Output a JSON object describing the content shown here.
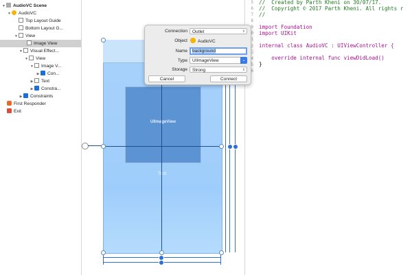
{
  "outline": {
    "items": [
      {
        "label": "AudioVC Scene",
        "bold": true
      },
      {
        "label": "AudioVC"
      },
      {
        "label": "Top Layout Guide"
      },
      {
        "label": "Bottom Layout G..."
      },
      {
        "label": "View"
      },
      {
        "label": "Image View",
        "selected": true
      },
      {
        "label": "Visual Effect..."
      },
      {
        "label": "View"
      },
      {
        "label": "Image V..."
      },
      {
        "label": "Con..."
      },
      {
        "label": "Text"
      },
      {
        "label": "Constra..."
      },
      {
        "label": "Constraints"
      },
      {
        "label": "First Responder"
      },
      {
        "label": "Exit"
      }
    ]
  },
  "canvas": {
    "image_view_label": "UIImageView",
    "text_label": "Text"
  },
  "popover": {
    "connection_label": "Connection",
    "connection_value": "Outlet",
    "object_label": "Object",
    "object_value": "AudioVC",
    "name_label": "Name",
    "name_value": "background",
    "type_label": "Type",
    "type_value": "UIImageView",
    "storage_label": "Storage",
    "storage_value": "Strong",
    "cancel": "Cancel",
    "connect": "Connect"
  },
  "editor": {
    "lines": [
      {
        "num": "5",
        "text": "//  Created by Parth Kheni on 30/07/17.",
        "style": "cm"
      },
      {
        "num": "6",
        "text": "//  Copyright © 2017 Parth Kheni. All rights r",
        "style": "cm"
      },
      {
        "num": "7",
        "text": "//",
        "style": "cm"
      },
      {
        "num": "8",
        "text": "",
        "style": ""
      },
      {
        "num": "9",
        "text": "import Foundation",
        "style": "imp"
      },
      {
        "num": "10",
        "text": "import UIKit",
        "style": "imp"
      },
      {
        "num": "11",
        "text": "",
        "style": ""
      },
      {
        "num": "12",
        "text": "internal class AudioVC : UIViewController {",
        "style": "cls"
      },
      {
        "num": "13",
        "text": "",
        "style": ""
      },
      {
        "num": "14",
        "text": "    override internal func viewDidLoad()",
        "style": "fn"
      },
      {
        "num": "15",
        "text": "",
        "style": ""
      },
      {
        "num": "16",
        "text": "}",
        "style": ""
      }
    ]
  },
  "colors": {
    "scene_blue": "#a8d2fb",
    "image_view": "#5b93d3",
    "accent": "#3a7ae8",
    "comment": "#1f7a1f",
    "keyword": "#aa0d91"
  }
}
